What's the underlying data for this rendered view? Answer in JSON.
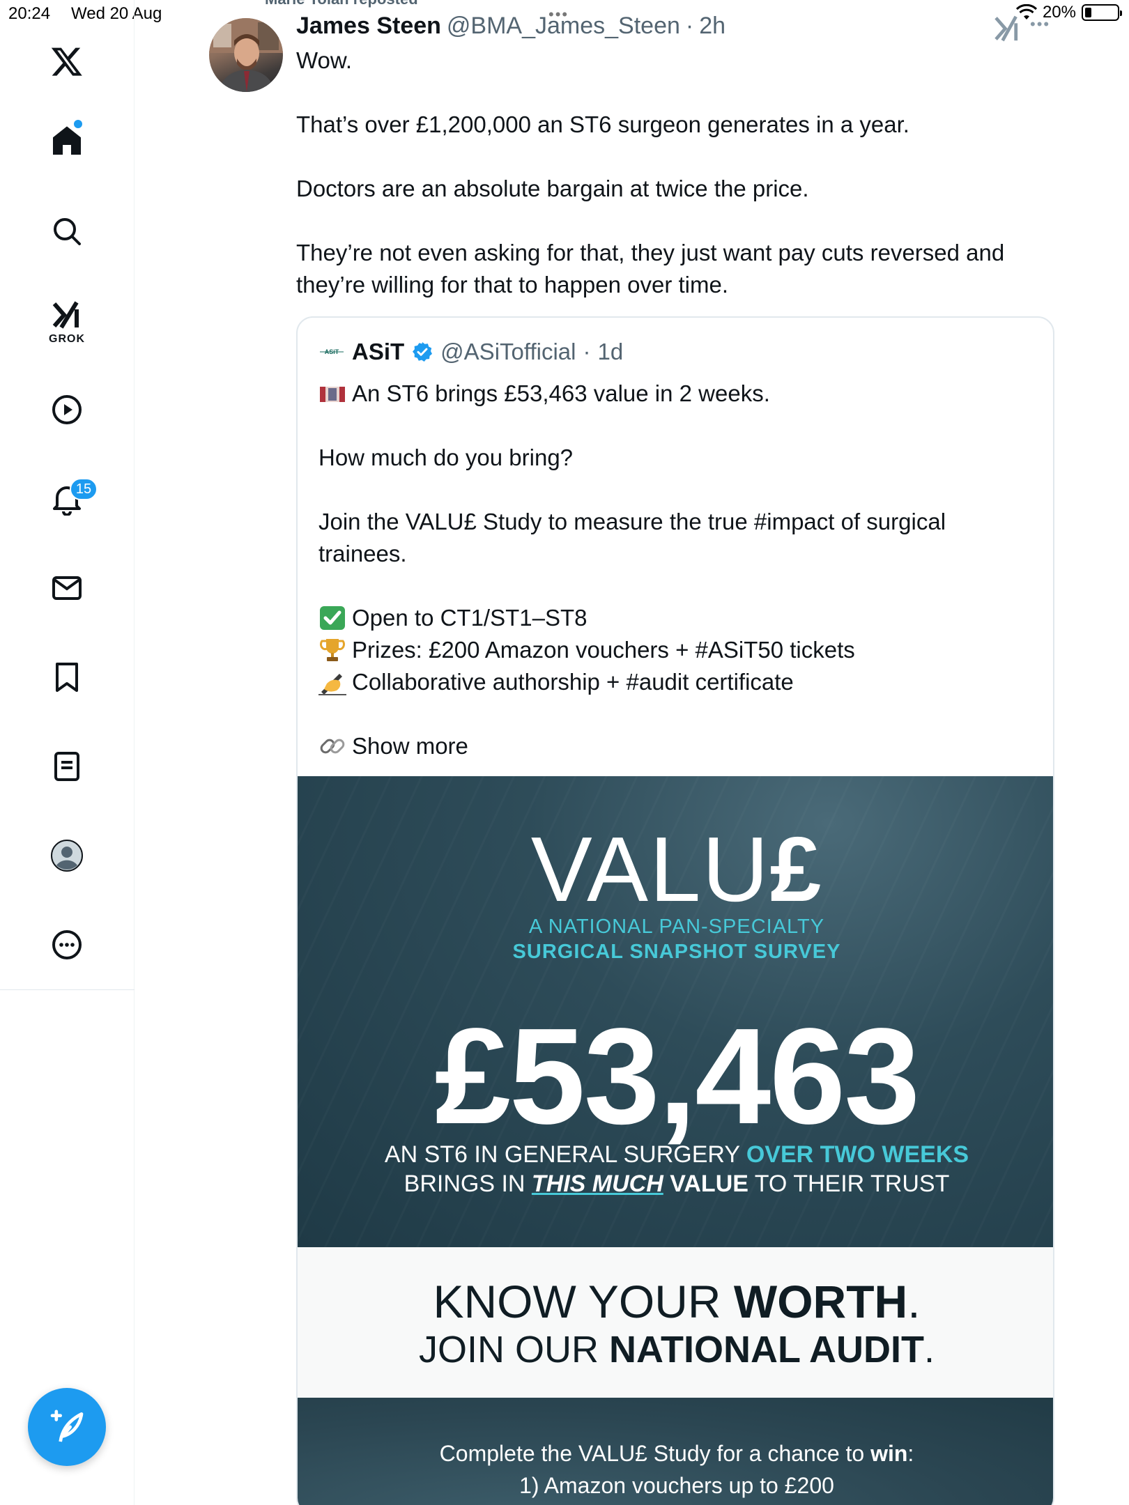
{
  "status_bar": {
    "time": "20:24",
    "date": "Wed 20 Aug",
    "battery_percent": "20%"
  },
  "sidebar": {
    "grok_label": "GROK",
    "notifications_count": "15"
  },
  "tweet": {
    "reposted_by": "Marie Tolan reposted",
    "author_name": "James Steen",
    "author_handle": "@BMA_James_Steen",
    "separator": "·",
    "time": "2h",
    "paragraphs": [
      "Wow.",
      "That’s over £1,200,000 an ST6 surgeon generates in a year.",
      "Doctors are an absolute bargain at twice the price.",
      "They’re not even asking for that, they just want pay cuts reversed and they’re willing for that to happen over time."
    ]
  },
  "quote": {
    "logo_text": "ASiT",
    "author_name": "ASiT",
    "author_handle": "@ASiTofficial",
    "separator": "·",
    "time": "1d",
    "line1": "An ST6 brings £53,463 value in 2 weeks.",
    "line2": "How much do you bring?",
    "line3": "Join the VALU£ Study to measure the true #impact of surgical trainees.",
    "bullet1": "Open to CT1/ST1–ST8",
    "bullet2": "Prizes: £200 Amazon vouchers + #ASiT50 tickets",
    "bullet3": "Collaborative authorship + #audit certificate",
    "show_more": "Show more"
  },
  "poster": {
    "title_main": "VALU",
    "title_pound": "£",
    "subtitle1": "A NATIONAL PAN-SPECIALTY",
    "subtitle2": "SURGICAL SNAPSHOT SURVEY",
    "amount": "£53,463",
    "caption1_a": "AN ST6 IN GENERAL SURGERY ",
    "caption1_b": "OVER TWO WEEKS",
    "caption2_a": "BRINGS IN ",
    "caption2_b": "THIS MUCH",
    "caption2_c": " VALUE",
    "caption2_d": " TO THEIR TRUST",
    "know_a": "KNOW YOUR ",
    "know_b": "WORTH",
    "know_c": ".",
    "join_a": "JOIN OUR ",
    "join_b": "NATIONAL AUDIT",
    "join_c": ".",
    "complete_a": "Complete the VALU£ Study for a chance to ",
    "complete_b": "win",
    "complete_c": ":",
    "prize1": "1) Amazon vouchers up to £200"
  },
  "colors": {
    "accent": "#1d9bf0",
    "poster_dark": "#2a4652",
    "poster_teal": "#47c9d8"
  }
}
